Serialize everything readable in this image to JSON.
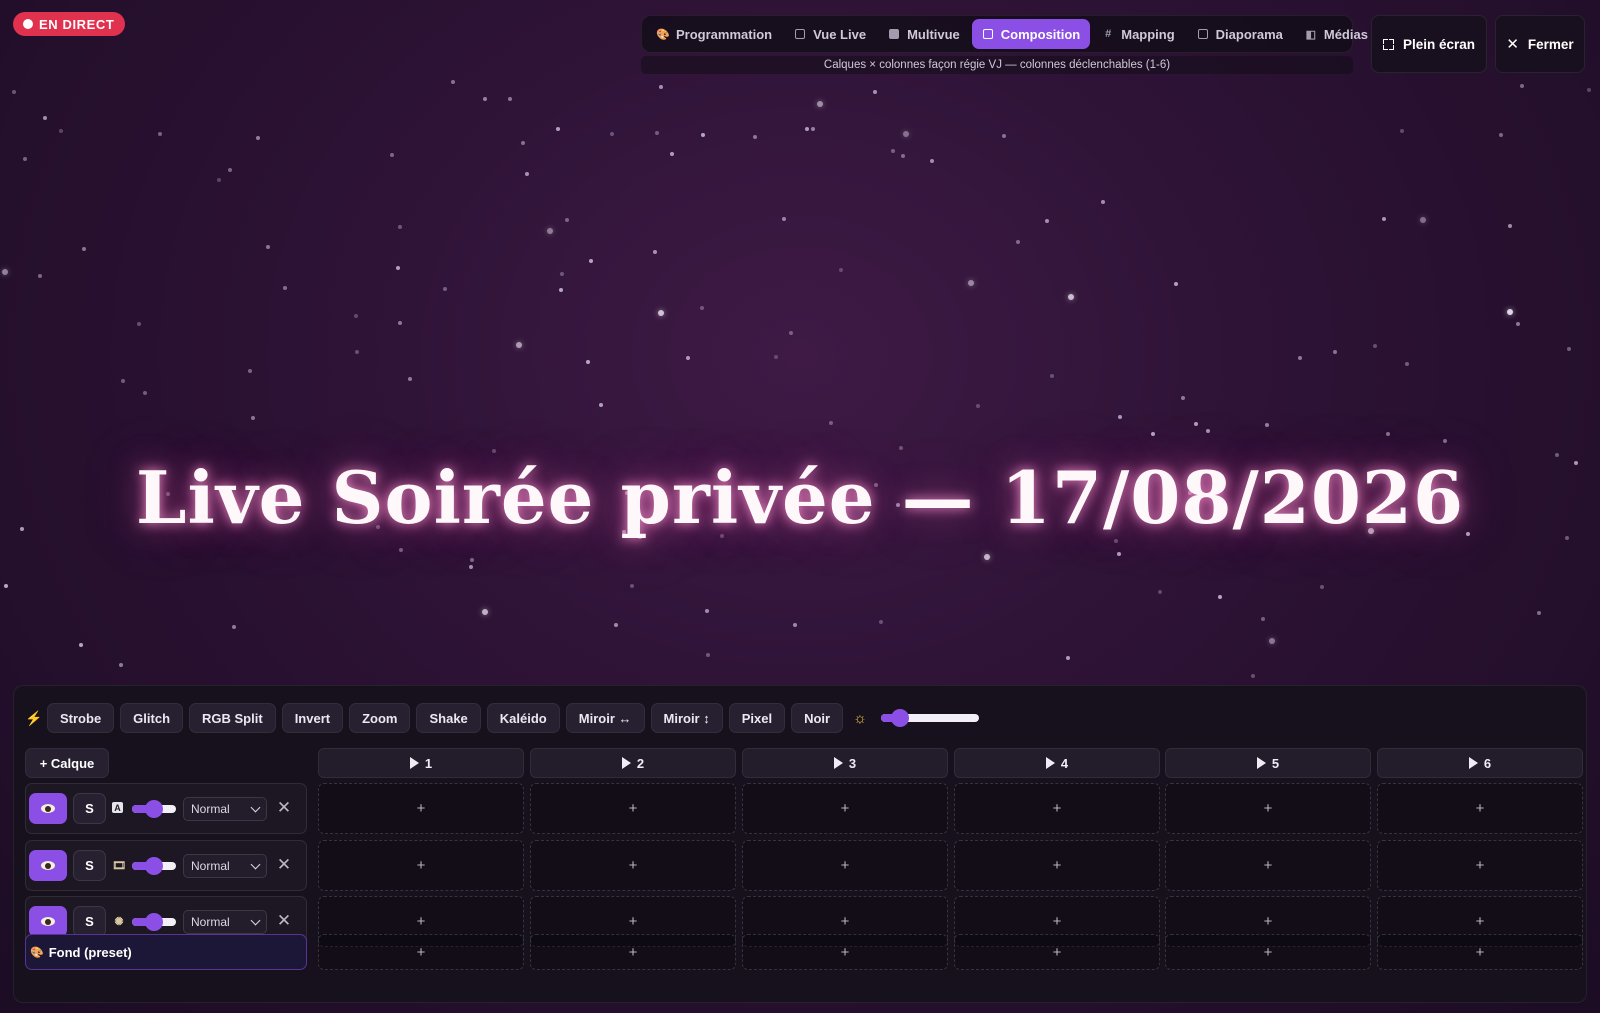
{
  "live_badge": {
    "label": "EN DIRECT",
    "color": "#e0314f"
  },
  "nav": {
    "tabs": [
      {
        "label": "Programmation",
        "icon": "palette-icon",
        "active": false
      },
      {
        "label": "Vue Live",
        "icon": "monitor-icon",
        "active": false
      },
      {
        "label": "Multivue",
        "icon": "grid-icon",
        "active": false
      },
      {
        "label": "Composition",
        "icon": "layers-icon",
        "active": true
      },
      {
        "label": "Mapping",
        "icon": "hash-icon",
        "active": false
      },
      {
        "label": "Diaporama",
        "icon": "slides-icon",
        "active": false
      },
      {
        "label": "Médias",
        "icon": "media-icon",
        "active": false
      }
    ],
    "subtitle": "Calques × colonnes façon régie VJ — colonnes déclenchables (1-6)"
  },
  "top_buttons": {
    "fullscreen_label": "Plein écran",
    "close_label": "Fermer"
  },
  "hero": {
    "title": "Live Soirée privée — 17/08/2026"
  },
  "effects": {
    "buttons": [
      "Strobe",
      "Glitch",
      "RGB Split",
      "Invert",
      "Zoom",
      "Shake",
      "Kaléido",
      "Miroir ↔",
      "Miroir ↕",
      "Pixel",
      "Noir"
    ],
    "brightness_fraction": 0.2
  },
  "composition": {
    "add_layer_label": "+ Calque",
    "columns": [
      "1",
      "2",
      "3",
      "4",
      "5",
      "6"
    ],
    "layers": [
      {
        "solo_label": "S",
        "type_icon": "text-icon",
        "opacity_fraction": 0.5,
        "blend": "Normal"
      },
      {
        "solo_label": "S",
        "type_icon": "media-icon",
        "opacity_fraction": 0.5,
        "blend": "Normal"
      },
      {
        "solo_label": "S",
        "type_icon": "particles-icon",
        "opacity_fraction": 0.5,
        "blend": "Normal"
      }
    ],
    "background_layer": {
      "label": "Fond (preset)",
      "icon": "palette-icon"
    },
    "cell_symbol": "+"
  },
  "colors": {
    "accent": "#8b4fe6",
    "live_red": "#e0314f",
    "hero_glow": "#e65aaa"
  }
}
